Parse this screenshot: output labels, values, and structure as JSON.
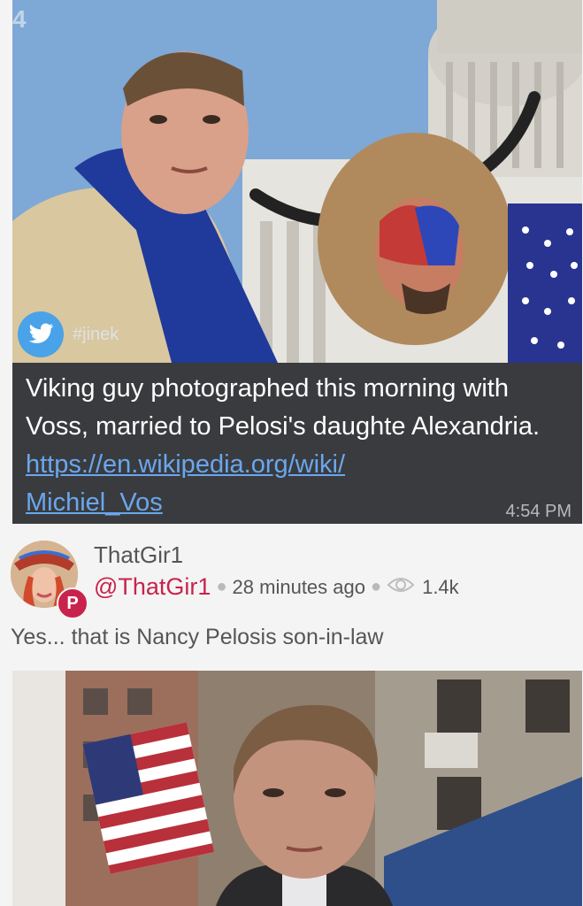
{
  "embedded_post": {
    "channel_mark": "4",
    "twitter_tag": "#jinek",
    "caption": "Viking guy photographed this morning with Voss, married to Pelosi's daughte Alexandria.",
    "link_line1": "https://en.wikipedia.org/wiki/",
    "link_line2": "Michiel_Vos",
    "time": "4:54 PM"
  },
  "post": {
    "display_name": "ThatGir1",
    "handle": "@ThatGir1",
    "time_ago": "28 minutes ago",
    "views": "1.4k",
    "text": "Yes... that is Nancy Pelosis son-in-law"
  },
  "colors": {
    "accent": "#c8234c",
    "card_background": "#3a3b3e",
    "link": "#6aa7ee",
    "twitter_blue": "#4aa3e8"
  },
  "icons": {
    "twitter": "twitter-bird-icon",
    "views": "eye-icon",
    "badge": "parler-badge-icon"
  }
}
